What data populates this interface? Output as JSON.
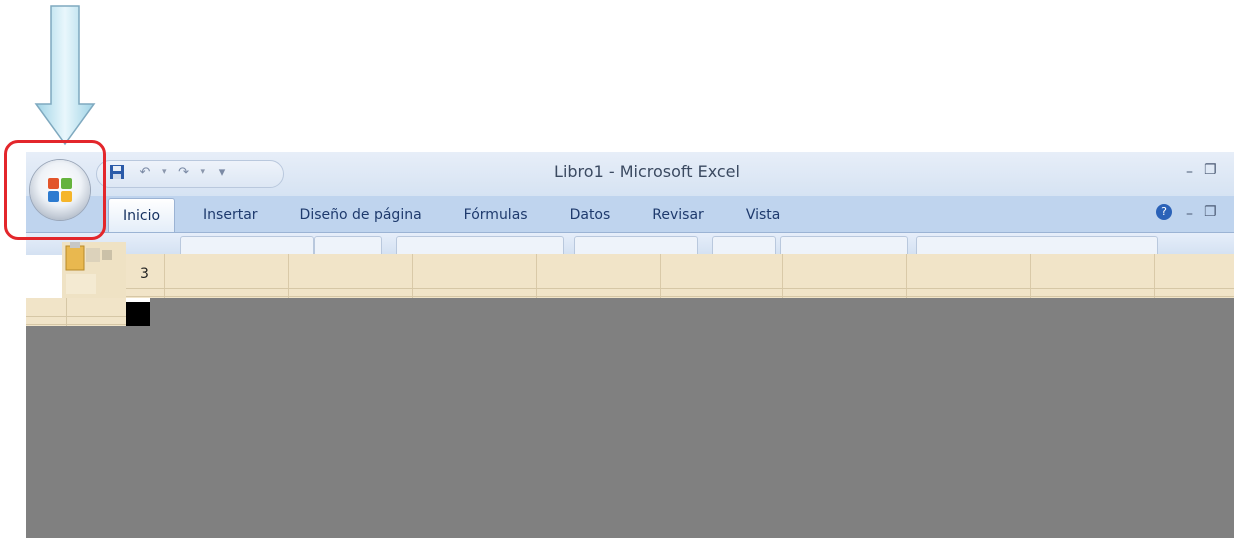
{
  "window": {
    "title": "Libro1 - Microsoft Excel"
  },
  "quick_access": {
    "items": [
      {
        "icon": "save-icon"
      },
      {
        "icon": "undo-icon"
      },
      {
        "icon": "redo-icon"
      },
      {
        "icon": "customize-dropdown-icon"
      }
    ]
  },
  "ribbon": {
    "tabs": [
      {
        "label": "Inicio",
        "active": true
      },
      {
        "label": "Insertar"
      },
      {
        "label": "Diseño de página"
      },
      {
        "label": "Fórmulas"
      },
      {
        "label": "Datos"
      },
      {
        "label": "Revisar"
      },
      {
        "label": "Vista"
      }
    ]
  },
  "sheet": {
    "visible_row_number": "3"
  },
  "annotation": {
    "arrow_icon": "down-arrow-icon",
    "highlight_color": "#e3262b"
  },
  "colors": {
    "tab_bar": "#bfd4ee",
    "cell_fill": "#f1e4c8",
    "background_grey": "#808080"
  }
}
